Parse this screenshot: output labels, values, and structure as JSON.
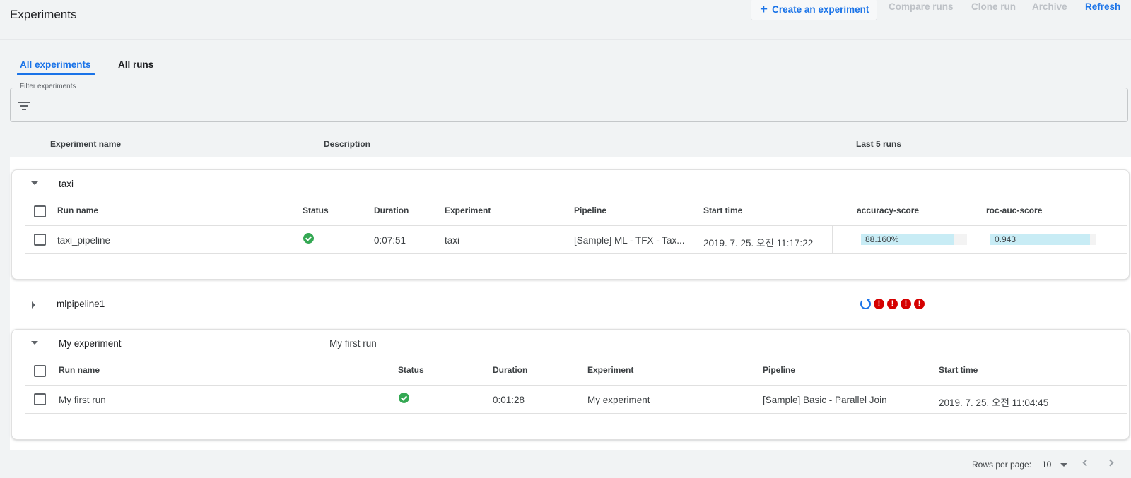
{
  "header": {
    "title": "Experiments",
    "actions": {
      "create": "Create an experiment",
      "create_icon": "plus-icon",
      "compare": "Compare runs",
      "clone": "Clone run",
      "archive": "Archive",
      "refresh": "Refresh"
    }
  },
  "tabs": [
    {
      "label": "All experiments",
      "active": true
    },
    {
      "label": "All runs",
      "active": false
    }
  ],
  "filter": {
    "label": "Filter experiments",
    "icon": "filter-list-icon"
  },
  "columns": {
    "name": "Experiment name",
    "description": "Description",
    "last_runs": "Last 5 runs"
  },
  "experiments": [
    {
      "name": "taxi",
      "description": "",
      "expanded": true,
      "run_headers": {
        "run_name": "Run name",
        "status": "Status",
        "duration": "Duration",
        "experiment": "Experiment",
        "pipeline": "Pipeline",
        "start_time": "Start time",
        "metric1": "accuracy-score",
        "metric2": "roc-auc-score"
      },
      "runs": [
        {
          "run_name": "taxi_pipeline",
          "status": "succeeded",
          "duration": "0:07:51",
          "experiment": "taxi",
          "pipeline": "[Sample] ML - TFX - Tax...",
          "start_time": "2019. 7. 25. 오전 11:17:22",
          "metric1": {
            "text": "88.160%",
            "value": 0.8816
          },
          "metric2": {
            "text": "0.943",
            "value": 0.943
          }
        }
      ]
    },
    {
      "name": "mlpipeline1",
      "description": "",
      "expanded": false,
      "last_runs": [
        "running",
        "error",
        "error",
        "error",
        "error"
      ],
      "error_glyph": "!"
    },
    {
      "name": "My experiment",
      "description": "My first run",
      "expanded": true,
      "run_headers": {
        "run_name": "Run name",
        "status": "Status",
        "duration": "Duration",
        "experiment": "Experiment",
        "pipeline": "Pipeline",
        "start_time": "Start time"
      },
      "runs": [
        {
          "run_name": "My first run",
          "status": "succeeded",
          "duration": "0:01:28",
          "experiment": "My experiment",
          "pipeline": "[Sample] Basic - Parallel Join",
          "start_time": "2019. 7. 25. 오전 11:04:45"
        }
      ]
    }
  ],
  "pagination": {
    "rows_label": "Rows per page:",
    "rows_value": "10"
  },
  "colors": {
    "accent": "#1a73e8",
    "success": "#34a853",
    "error": "#d50000",
    "metric_fill": "#c8ecf5"
  }
}
